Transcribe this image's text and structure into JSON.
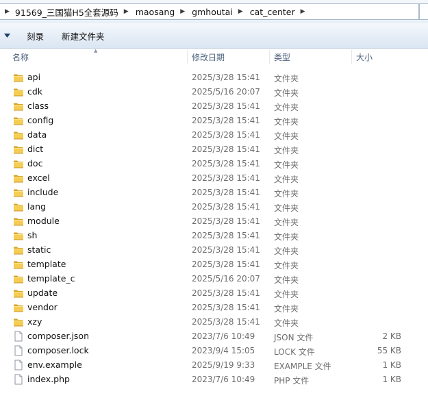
{
  "address_bar": {
    "breadcrumbs": [
      "91569_三国猫H5全套源码",
      "maosang",
      "gmhoutai",
      "cat_center"
    ]
  },
  "toolbar": {
    "burn_label": "刻录",
    "new_folder_label": "新建文件夹"
  },
  "columns": {
    "name": "名称",
    "date": "修改日期",
    "type": "类型",
    "size": "大小"
  },
  "icons": {
    "folder": "folder-icon",
    "file": "file-icon"
  },
  "files": [
    {
      "name": "api",
      "date": "2025/3/28 15:41",
      "type": "文件夹",
      "size": "",
      "kind": "folder"
    },
    {
      "name": "cdk",
      "date": "2025/5/16 20:07",
      "type": "文件夹",
      "size": "",
      "kind": "folder"
    },
    {
      "name": "class",
      "date": "2025/3/28 15:41",
      "type": "文件夹",
      "size": "",
      "kind": "folder"
    },
    {
      "name": "config",
      "date": "2025/3/28 15:41",
      "type": "文件夹",
      "size": "",
      "kind": "folder"
    },
    {
      "name": "data",
      "date": "2025/3/28 15:41",
      "type": "文件夹",
      "size": "",
      "kind": "folder"
    },
    {
      "name": "dict",
      "date": "2025/3/28 15:41",
      "type": "文件夹",
      "size": "",
      "kind": "folder"
    },
    {
      "name": "doc",
      "date": "2025/3/28 15:41",
      "type": "文件夹",
      "size": "",
      "kind": "folder"
    },
    {
      "name": "excel",
      "date": "2025/3/28 15:41",
      "type": "文件夹",
      "size": "",
      "kind": "folder"
    },
    {
      "name": "include",
      "date": "2025/3/28 15:41",
      "type": "文件夹",
      "size": "",
      "kind": "folder"
    },
    {
      "name": "lang",
      "date": "2025/3/28 15:41",
      "type": "文件夹",
      "size": "",
      "kind": "folder"
    },
    {
      "name": "module",
      "date": "2025/3/28 15:41",
      "type": "文件夹",
      "size": "",
      "kind": "folder"
    },
    {
      "name": "sh",
      "date": "2025/3/28 15:41",
      "type": "文件夹",
      "size": "",
      "kind": "folder"
    },
    {
      "name": "static",
      "date": "2025/3/28 15:41",
      "type": "文件夹",
      "size": "",
      "kind": "folder"
    },
    {
      "name": "template",
      "date": "2025/3/28 15:41",
      "type": "文件夹",
      "size": "",
      "kind": "folder"
    },
    {
      "name": "template_c",
      "date": "2025/5/16 20:07",
      "type": "文件夹",
      "size": "",
      "kind": "folder"
    },
    {
      "name": "update",
      "date": "2025/3/28 15:41",
      "type": "文件夹",
      "size": "",
      "kind": "folder"
    },
    {
      "name": "vendor",
      "date": "2025/3/28 15:41",
      "type": "文件夹",
      "size": "",
      "kind": "folder"
    },
    {
      "name": "xzy",
      "date": "2025/3/28 15:41",
      "type": "文件夹",
      "size": "",
      "kind": "folder"
    },
    {
      "name": "composer.json",
      "date": "2023/7/6 10:49",
      "type": "JSON 文件",
      "size": "2 KB",
      "kind": "file"
    },
    {
      "name": "composer.lock",
      "date": "2023/9/4 15:05",
      "type": "LOCK 文件",
      "size": "55 KB",
      "kind": "file"
    },
    {
      "name": "env.example",
      "date": "2025/9/19 9:33",
      "type": "EXAMPLE 文件",
      "size": "1 KB",
      "kind": "file"
    },
    {
      "name": "index.php",
      "date": "2023/7/6 10:49",
      "type": "PHP 文件",
      "size": "1 KB",
      "kind": "file"
    }
  ]
}
